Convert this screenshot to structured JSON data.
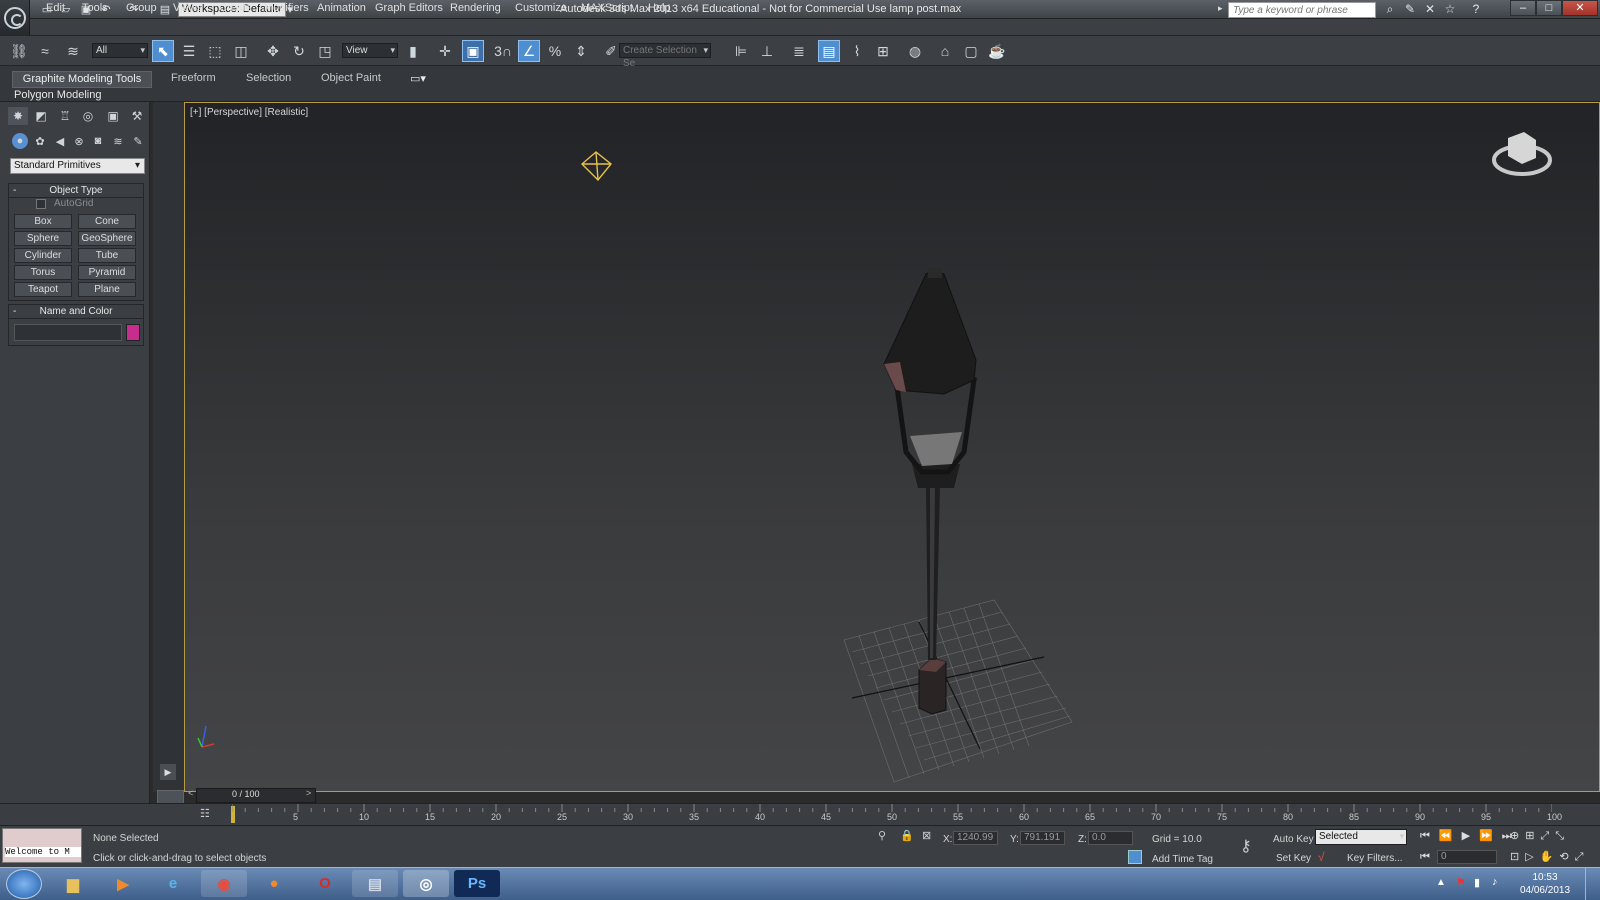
{
  "titlebar": {
    "workspace": "Workspace: Default",
    "title": "Autodesk 3ds Max  2013 x64    Educational - Not for Commercial Use    lamp post.max",
    "search_placeholder": "Type a keyword or phrase"
  },
  "menu": [
    "Edit",
    "Tools",
    "Group",
    "Views",
    "Create",
    "Modifiers",
    "Animation",
    "Graph Editors",
    "Rendering",
    "Customize",
    "MAXScript",
    "Help"
  ],
  "toolbar": {
    "selection_filter": "All",
    "ref_coord": "View",
    "snap_label": "3",
    "selection_set_placeholder": "Create Selection Se"
  },
  "ribbon": {
    "tabs": [
      "Graphite Modeling Tools",
      "Freeform",
      "Selection",
      "Object Paint"
    ],
    "panel": "Polygon Modeling"
  },
  "command_panel": {
    "category": "Standard Primitives",
    "object_type_title": "Object Type",
    "autogrid": "AutoGrid",
    "buttons": [
      "Box",
      "Cone",
      "Sphere",
      "GeoSphere",
      "Cylinder",
      "Tube",
      "Torus",
      "Pyramid",
      "Teapot",
      "Plane"
    ],
    "name_color_title": "Name and Color",
    "color": "#c72d8c"
  },
  "viewport": {
    "label": "[+] [Perspective] [Realistic]"
  },
  "timeline": {
    "frame": "0 / 100",
    "ticks": [
      "5",
      "10",
      "15",
      "20",
      "25",
      "30",
      "35",
      "40",
      "45",
      "50",
      "55",
      "60",
      "65",
      "70",
      "75",
      "80",
      "85",
      "90",
      "95",
      "100"
    ]
  },
  "status": {
    "welcome": "Welcome to M",
    "selection": "None Selected",
    "prompt": "Click or click-and-drag to select objects",
    "x_label": "X:",
    "x_value": "1240.99",
    "y_label": "Y:",
    "y_value": "791.191",
    "z_label": "Z:",
    "z_value": "0.0",
    "grid": "Grid = 10.0",
    "add_time_tag": "Add Time Tag",
    "auto_key": "Auto Key",
    "set_key": "Set Key",
    "key_mode": "Selected",
    "key_filters": "Key Filters...",
    "frame_field": "0"
  },
  "taskbar": {
    "time": "10:53",
    "date": "04/06/2013",
    "ps_label": "Ps"
  }
}
